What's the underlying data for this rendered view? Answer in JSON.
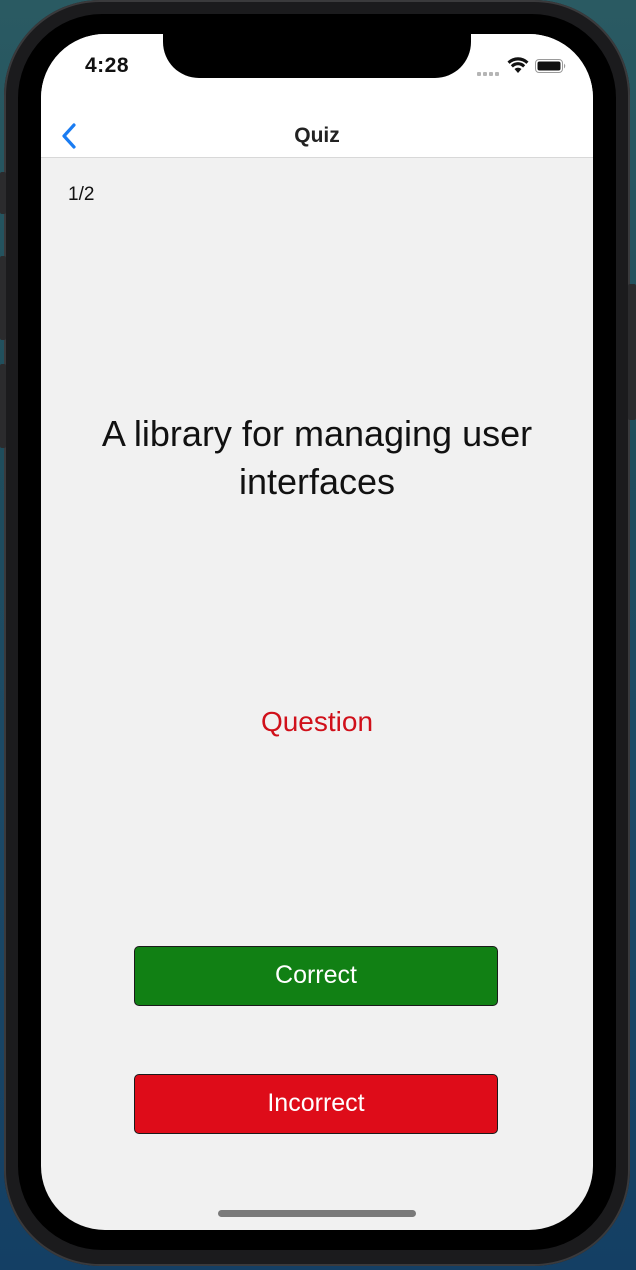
{
  "status_bar": {
    "time": "4:28"
  },
  "nav": {
    "title": "Quiz",
    "back_icon": "chevron-left-icon"
  },
  "quiz": {
    "counter": "1/2",
    "prompt": "A library for managing user interfaces",
    "card_side": "Question",
    "correct_label": "Correct",
    "incorrect_label": "Incorrect"
  },
  "colors": {
    "accent": "#1a7cf2",
    "correct": "#118014",
    "incorrect": "#de0c19",
    "question_text": "#d0101a",
    "background": "#f1f1f1"
  }
}
